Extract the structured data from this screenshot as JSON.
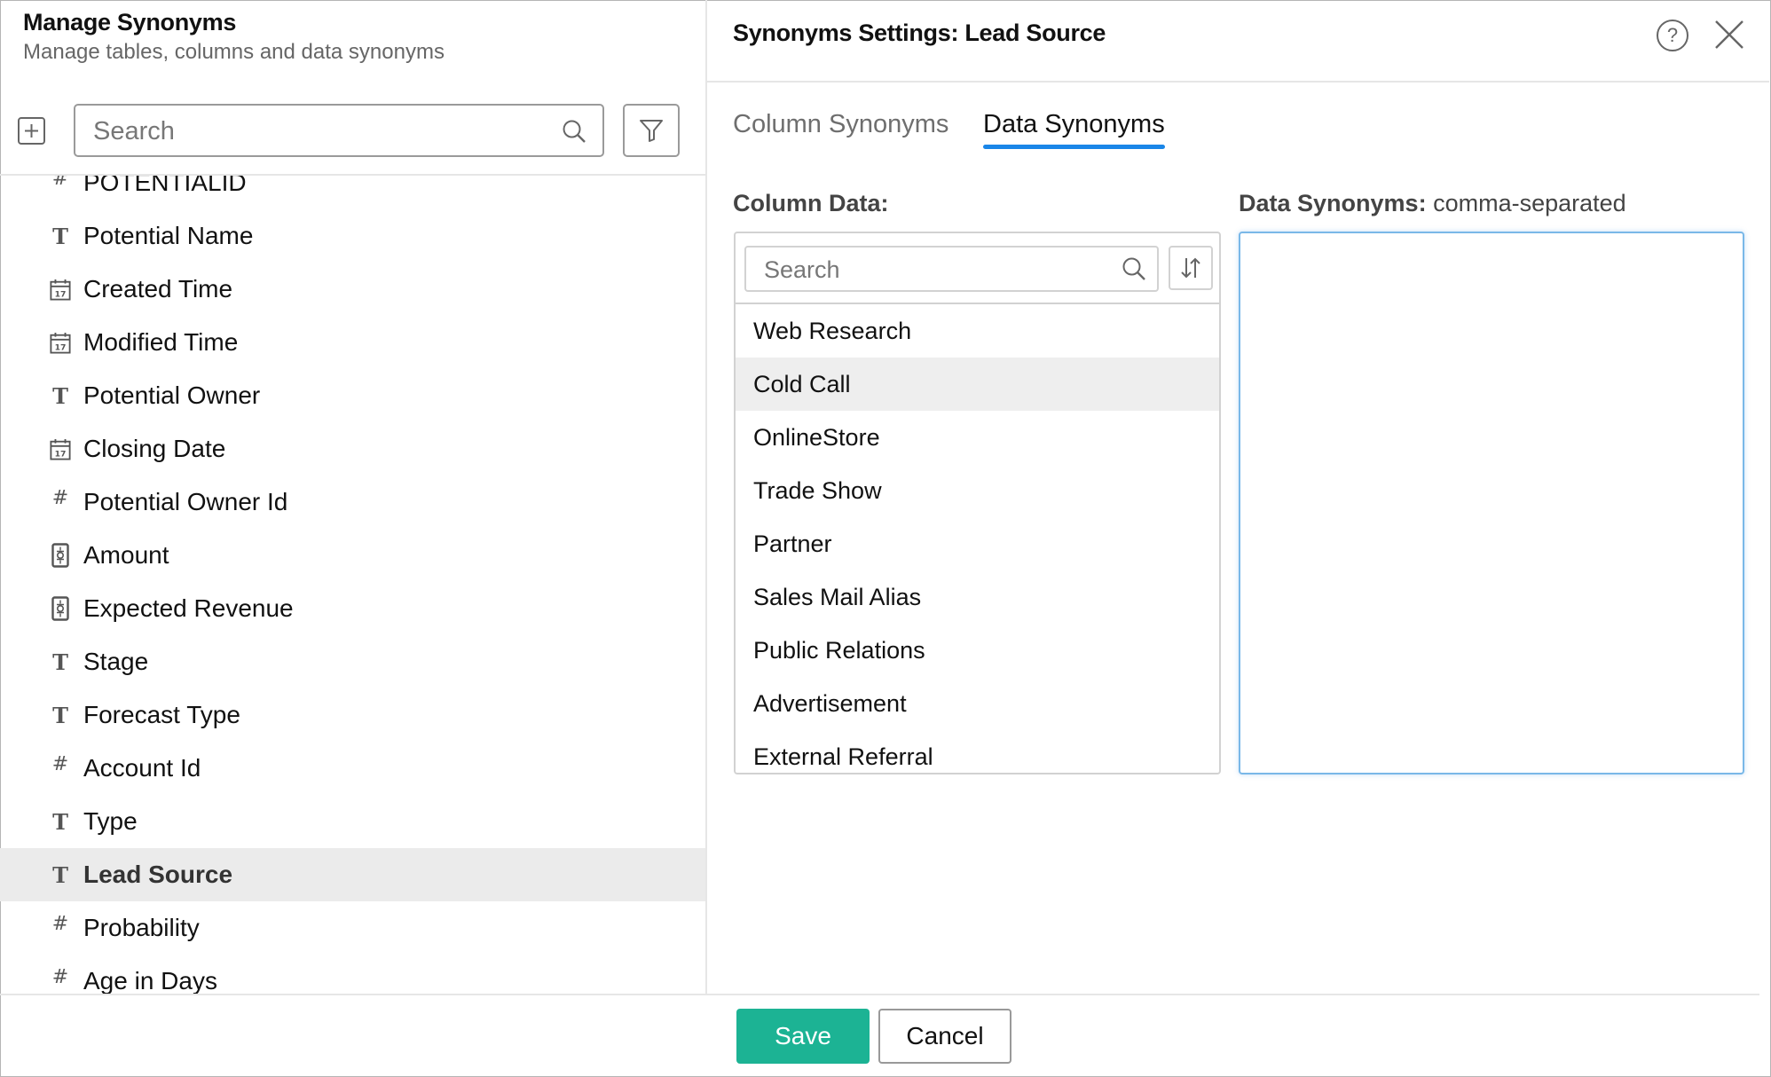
{
  "left_panel": {
    "title": "Manage Synonyms",
    "subtitle": "Manage tables, columns and data synonyms",
    "search_placeholder": "Search",
    "columns": [
      {
        "label": "POTENTIALID",
        "type": "number",
        "icon": "hash-icon"
      },
      {
        "label": "Potential Name",
        "type": "text",
        "icon": "text-type-icon"
      },
      {
        "label": "Created Time",
        "type": "date",
        "icon": "calendar-icon"
      },
      {
        "label": "Modified Time",
        "type": "date",
        "icon": "calendar-icon"
      },
      {
        "label": "Potential Owner",
        "type": "text",
        "icon": "text-type-icon"
      },
      {
        "label": "Closing Date",
        "type": "date",
        "icon": "calendar-icon"
      },
      {
        "label": "Potential Owner Id",
        "type": "number",
        "icon": "hash-icon"
      },
      {
        "label": "Amount",
        "type": "currency",
        "icon": "currency-icon"
      },
      {
        "label": "Expected Revenue",
        "type": "currency",
        "icon": "currency-icon"
      },
      {
        "label": "Stage",
        "type": "text",
        "icon": "text-type-icon"
      },
      {
        "label": "Forecast Type",
        "type": "text",
        "icon": "text-type-icon"
      },
      {
        "label": "Account Id",
        "type": "number",
        "icon": "hash-icon"
      },
      {
        "label": "Type",
        "type": "text",
        "icon": "text-type-icon"
      },
      {
        "label": "Lead Source",
        "type": "text",
        "icon": "text-type-icon",
        "selected": true
      },
      {
        "label": "Probability",
        "type": "number",
        "icon": "hash-icon"
      },
      {
        "label": "Age in Days",
        "type": "number",
        "icon": "hash-icon"
      }
    ]
  },
  "right_panel": {
    "title": "Synonyms Settings: Lead Source",
    "tabs": [
      {
        "label": "Column Synonyms",
        "active": false
      },
      {
        "label": "Data Synonyms",
        "active": true
      }
    ],
    "column_data_label": "Column Data:",
    "column_data_search_placeholder": "Search",
    "column_data_values": [
      "Web Research",
      "Cold Call",
      "OnlineStore",
      "Trade Show",
      "Partner",
      "Sales Mail Alias",
      "Public Relations",
      "Advertisement",
      "External Referral"
    ],
    "hovered_value": "Cold Call",
    "data_synonyms_label": "Data Synonyms:",
    "data_synonyms_hint": "comma-separated",
    "data_synonyms_value": ""
  },
  "footer": {
    "save_label": "Save",
    "cancel_label": "Cancel"
  },
  "colors": {
    "accent_blue": "#1a86e8",
    "save_green": "#1cb394",
    "selected_row": "#ebebeb"
  }
}
